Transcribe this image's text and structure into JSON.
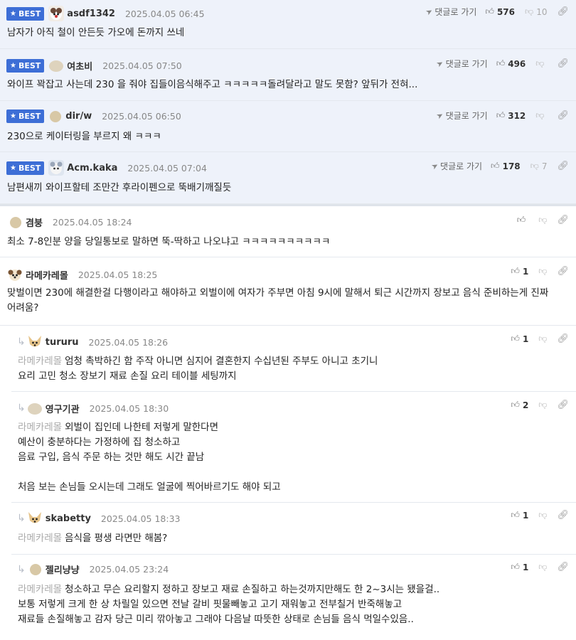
{
  "best_badge": "BEST",
  "goto_label": "댓글로 가기",
  "best_comments": [
    {
      "nick": "asdf1342",
      "date": "2025.04.05 06:45",
      "up": "576",
      "down": "10",
      "text": "남자가 아직 철이 안든듯 가오에 돈까지 쓰네"
    },
    {
      "nick": "여초비",
      "date": "2025.04.05 07:50",
      "up": "496",
      "down": "",
      "text": "와이프 꽉잡고 사는데 230 을 줘야 집들이음식해주고 ㅋㅋㅋㅋㅋ돌려달라고 말도 못함? 앞뒤가 전혀..."
    },
    {
      "nick": "dir/w",
      "date": "2025.04.05 06:50",
      "up": "312",
      "down": "",
      "text": "230으로 케이터링을 부르지 왜 ㅋㅋㅋ"
    },
    {
      "nick": "Acm.kaka",
      "date": "2025.04.05 07:04",
      "up": "178",
      "down": "7",
      "text": "남편새끼 와이프할테 조만간 후라이펜으로 뚝배기깨질듯"
    }
  ],
  "comments": [
    {
      "nick": "겸붕",
      "date": "2025.04.05 18:24",
      "up": "",
      "lines": [
        "최소 7-8인분 양을 당일통보로 말하면 뚝-딱하고 나오냐고 ㅋㅋㅋㅋㅋㅋㅋㅋㅋㅋ"
      ]
    },
    {
      "nick": "라메카레몰",
      "date": "2025.04.05 18:25",
      "up": "1",
      "lines": [
        "맞벌이면 230에 해결한걸 다행이라고 해야하고 외벌이에 여자가 주부면 아침 9시에 말해서 퇴근 시간까지 장보고 음식 준비하는게 진짜",
        "어려움?"
      ]
    }
  ],
  "replies": [
    {
      "nick": "tururu",
      "date": "2025.04.05 18:26",
      "up": "1",
      "mention": "라메카레몰",
      "lines": [
        "엄청 촉박하긴 함 주작 아니면 심지어 결혼한지 수십년된 주부도 아니고 초기니",
        "요리 고민 청소 장보기 재료 손질 요리 테이블 세팅까지"
      ]
    },
    {
      "nick": "영구기관",
      "date": "2025.04.05 18:30",
      "up": "2",
      "mention": "라메카레몰",
      "lines": [
        "외벌이 집인데 나한테 저렇게 말한다면",
        "예산이 충분하다는 가정하에 집 청소하고",
        "음료 구입, 음식 주문 하는 것만 해도 시간 끝남",
        "",
        "처음 보는 손님들 오시는데 그래도 얼굴에 찍어바르기도 해야 되고"
      ]
    },
    {
      "nick": "skabetty",
      "date": "2025.04.05 18:33",
      "up": "1",
      "mention": "라메카레몰",
      "lines": [
        "음식을 평생 라면만 해봄?"
      ]
    },
    {
      "nick": "젤리냥냥",
      "date": "2025.04.05 23:24",
      "up": "1",
      "mention": "라메카레몰",
      "lines": [
        "청소하고 무슨 요리할지 정하고 장보고 재료 손질하고 하는것까지만해도 한 2~3시는 됐을걸..",
        "보통 저렇게 크게 한 상 차릴일 있으면 전날 갈비 핏물빼놓고 고기 재워놓고 전부칠거 반죽해놓고",
        "재료들 손질해놓고 감자 당근 미리 깎아놓고 그래야 다음날 따뜻한 상태로 손님들 음식 먹일수있음.."
      ]
    }
  ]
}
